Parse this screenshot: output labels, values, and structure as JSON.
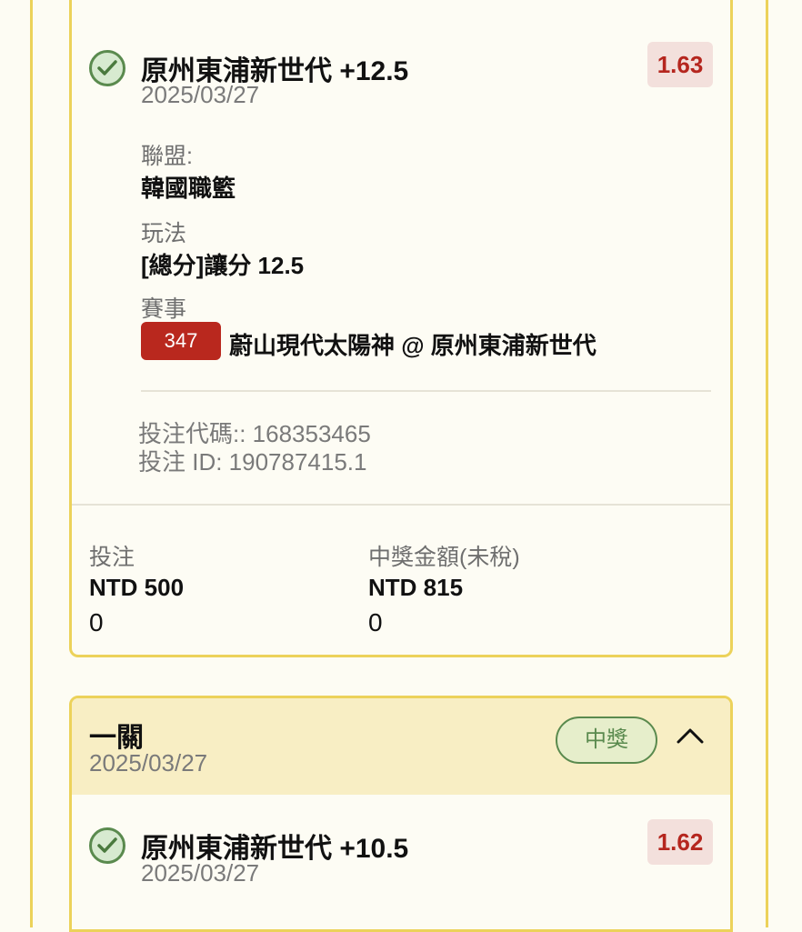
{
  "colors": {
    "accent_border": "#ecd25a",
    "won_green": "#5a8a4e",
    "odds_red": "#b5261e",
    "badge_red": "#b9281e",
    "header_bg": "#f8eec4",
    "page_bg": "#fdfcf3"
  },
  "bet1": {
    "selection": "原州東浦新世代 +12.5",
    "date": "2025/03/27",
    "odds": "1.63",
    "league_label": "聯盟:",
    "league_value": "韓國職籃",
    "market_label": "玩法",
    "market_value": "[總分]讓分 12.5",
    "event_label": "賽事",
    "event_number": "347",
    "event_name": "蔚山現代太陽神 @ 原州東浦新世代",
    "bet_code": "投注代碼:: 168353465",
    "bet_id": "投注 ID: 190787415.1",
    "stake_label": "投注",
    "stake_value": "NTD 500",
    "stake_extra": "0",
    "payout_label": "中獎金額(未稅)",
    "payout_value": "NTD 815",
    "payout_extra": "0",
    "status_icon": "check-circle-icon"
  },
  "bet2": {
    "type_label": "一關",
    "date": "2025/03/27",
    "status_label": "中獎",
    "collapse_icon": "chevron-up-icon",
    "selection": "原州東浦新世代 +10.5",
    "selection_date": "2025/03/27",
    "odds": "1.62",
    "status_icon": "check-circle-icon"
  }
}
